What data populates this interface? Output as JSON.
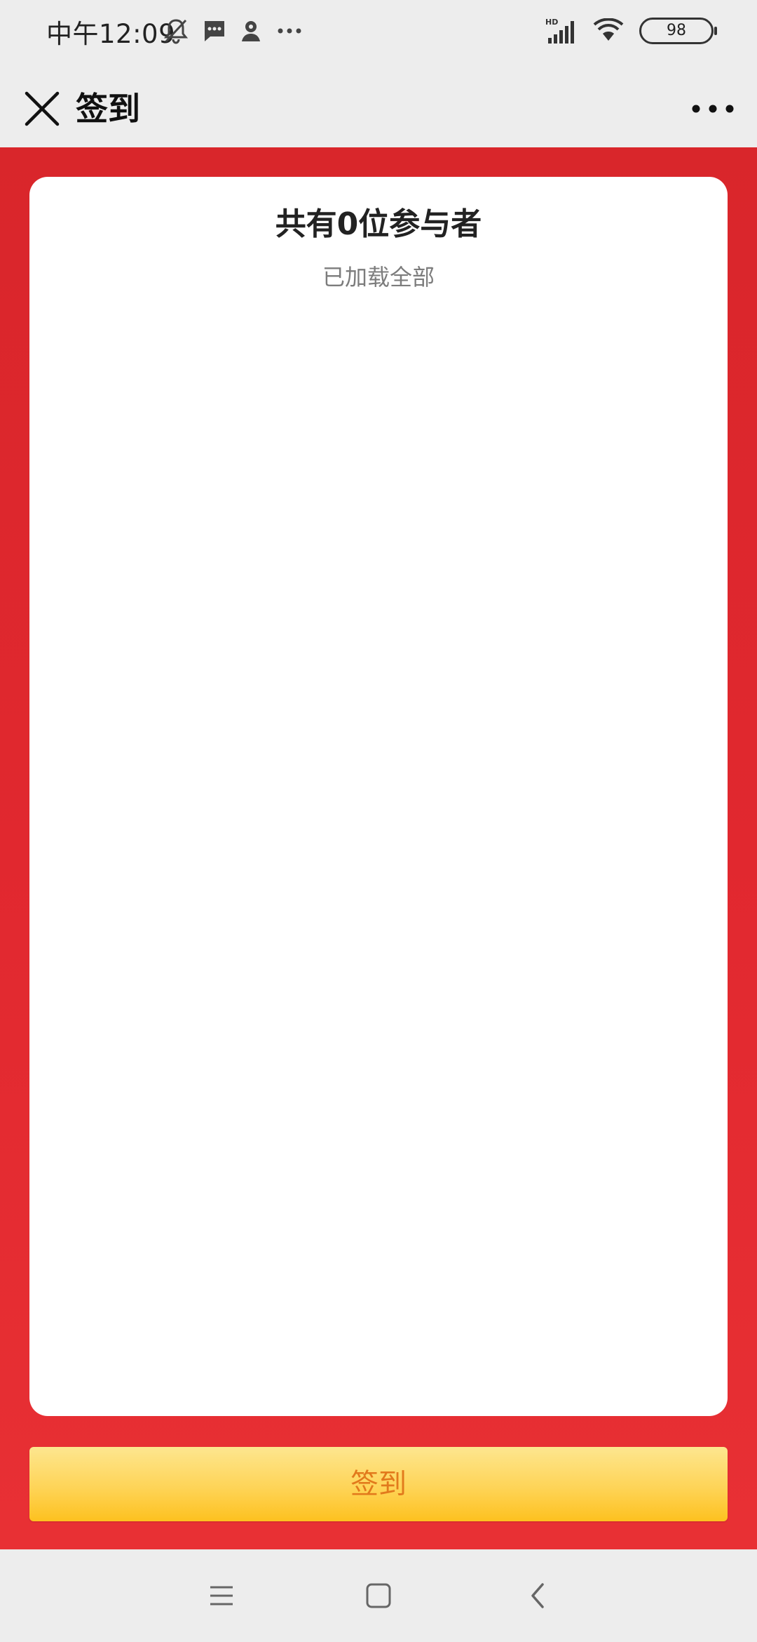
{
  "status_bar": {
    "time": "中午12:09",
    "icons_left": [
      "bell-muted-icon",
      "message-icon",
      "location-person-icon",
      "more-dots-icon"
    ],
    "icons_right": [
      "signal-hd-icon",
      "wifi-icon",
      "battery-icon"
    ],
    "battery_level": "98"
  },
  "nav_bar": {
    "title": "签到",
    "close_icon": "close-icon",
    "more_icon": "more-horizontal-icon"
  },
  "card": {
    "title": "共有0位参与者",
    "subtitle": "已加载全部"
  },
  "action": {
    "signin_label": "签到"
  },
  "system_nav": {
    "icons": [
      "menu-icon",
      "home-square-icon",
      "back-chevron-icon"
    ]
  },
  "colors": {
    "background_red": "#e1282f",
    "card_white": "#ffffff",
    "button_gradient_top": "#fde68f",
    "button_gradient_bottom": "#fdc11f",
    "button_text": "#e27a1c",
    "system_gray": "#ededed"
  }
}
